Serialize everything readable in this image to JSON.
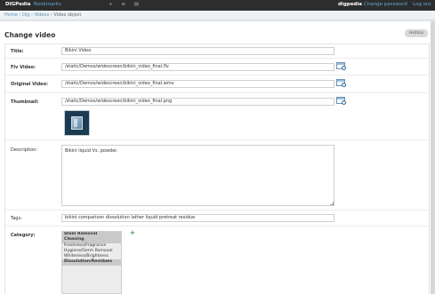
{
  "topbar": {
    "brand": "DIGPedia",
    "bookmarks": "Bookmarks",
    "tools": "+ ≡ ▤",
    "user": "digpedia",
    "change_password": "Change password",
    "logout": "Log out"
  },
  "breadcrumb": {
    "home": "Home",
    "sep": " › ",
    "app": "Dig",
    "model": "Videos",
    "current": "Video object"
  },
  "page": {
    "title": "Change video",
    "history_label": "History"
  },
  "form": {
    "title_label": "Title:",
    "title_value": "Bikini Video",
    "flv_label": "Flv Video:",
    "flv_value": "/static/Demos/widescreen/bikini_video_final.flv",
    "original_label": "Original Video:",
    "original_value": "/static/Demos/widescreen/bikini_video_final.wmv",
    "thumb_label": "Thumbnail:",
    "thumb_value": "/static/Demos/widescreen/bikini_video_final.png",
    "desc_label": "Description:",
    "desc_value": "Bikini liquid Vs. powder.",
    "tags_label": "Tags:",
    "tags_value": "bikini comparison dissolution lather liquid pretreat residue",
    "category_label": "Category:",
    "add_category": "+",
    "categories": [
      {
        "label": "Stain Removal",
        "selected": true
      },
      {
        "label": "Cleaning",
        "selected": true
      },
      {
        "label": "Freshness/Fragrance",
        "selected": false
      },
      {
        "label": "Hygiene/Germ Removal",
        "selected": false
      },
      {
        "label": "Whiteness/Brightness",
        "selected": false
      },
      {
        "label": "Dissolution/Residues",
        "selected": true
      }
    ]
  },
  "icons": {
    "browse": "file-browser-icon",
    "add": "add-icon"
  },
  "colors": {
    "topbar": "#2d2d2d",
    "link": "#5fa8d3",
    "add_green": "#2f9a3c"
  }
}
